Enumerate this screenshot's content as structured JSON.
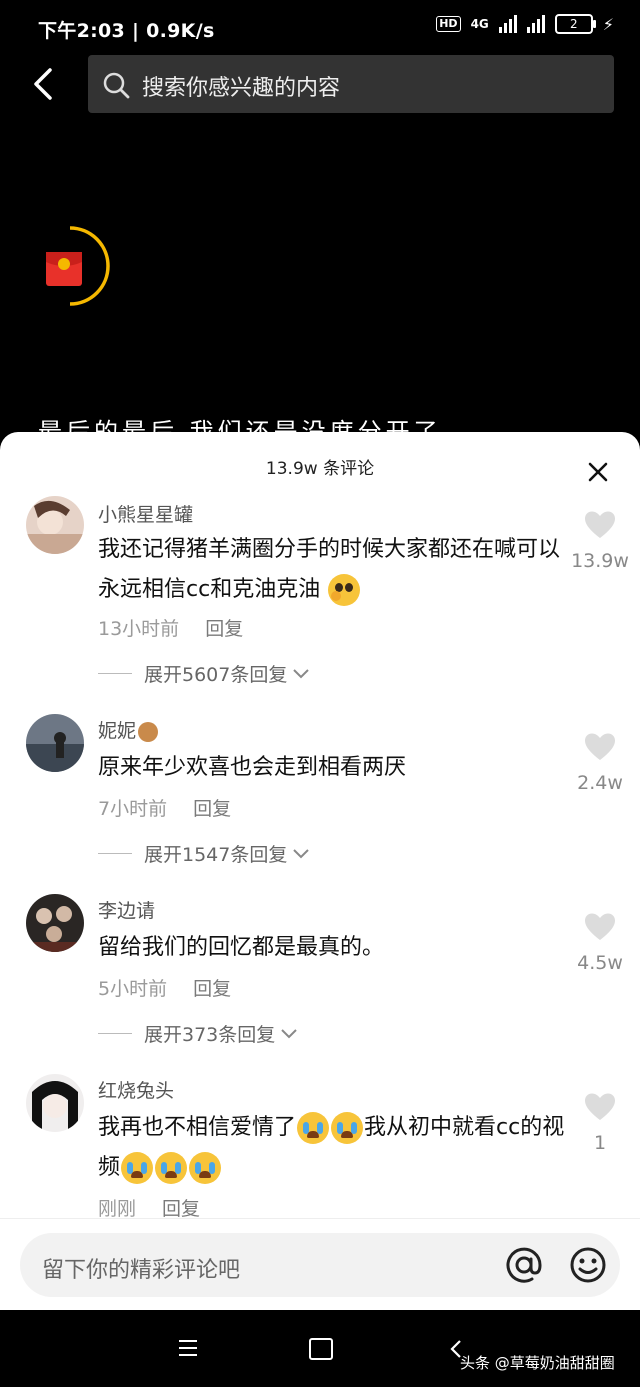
{
  "status_bar": {
    "time_speed": "下午2:03 | 0.9K/s",
    "hd": "HD",
    "network": "4G",
    "battery": "2"
  },
  "search": {
    "placeholder": "搜索你感兴趣的内容"
  },
  "video_caption": "最后的最后 我们还是没度分开了",
  "sheet": {
    "title": "13.9w 条评论",
    "comments": [
      {
        "name": "小熊星星罐",
        "text": "我还记得猪羊满圈分手的时候大家都还在喊可以永远相信cc和克油克油",
        "time": "13小时前",
        "reply": "回复",
        "expand": "展开5607条回复",
        "likes": "13.9w"
      },
      {
        "name": "妮妮",
        "text": "原来年少欢喜也会走到相看两厌",
        "time": "7小时前",
        "reply": "回复",
        "expand": "展开1547条回复",
        "likes": "2.4w"
      },
      {
        "name": "李边请",
        "text": "留给我们的回忆都是最真的。",
        "time": "5小时前",
        "reply": "回复",
        "expand": "展开373条回复",
        "likes": "4.5w"
      },
      {
        "name": "红烧兔头",
        "text_part1": "我再也不相信爱情了",
        "text_part2": "我从初中就看cc的视频",
        "time": "刚刚",
        "reply": "回复",
        "likes": "1"
      }
    ]
  },
  "input": {
    "placeholder": "留下你的精彩评论吧"
  },
  "watermark": "头条 @草莓奶油甜甜圈",
  "colors": {
    "sheet_bg": "#ffffff",
    "red_packet": "#e8312a",
    "gold": "#f5b800"
  }
}
